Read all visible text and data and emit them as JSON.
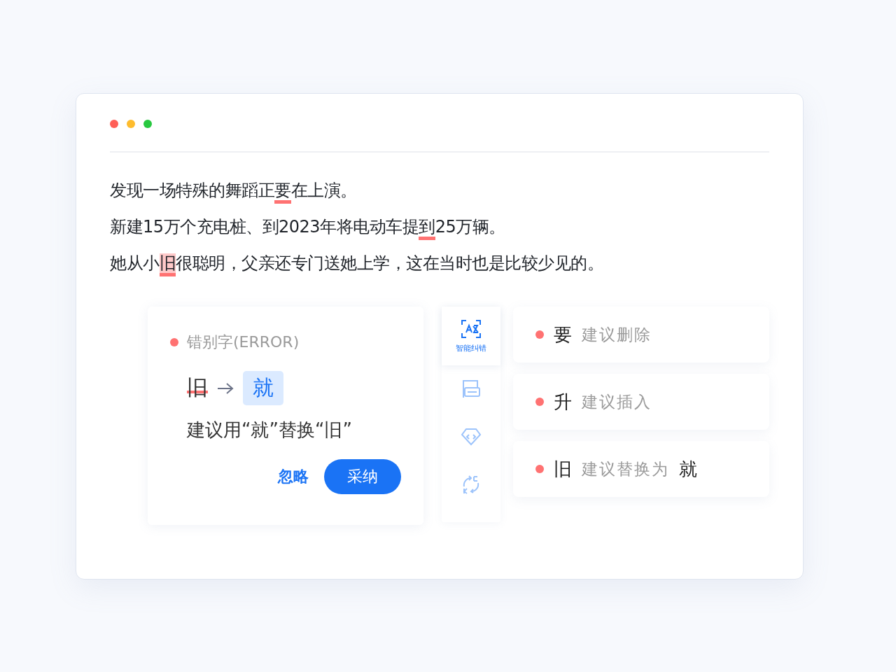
{
  "window": {
    "controls": [
      {
        "color": "#ff5f57"
      },
      {
        "color": "#febc2e"
      },
      {
        "color": "#28c840"
      }
    ]
  },
  "sentences": [
    {
      "segments": [
        {
          "kind": "plain",
          "text": "发现一场特殊的舞蹈正"
        },
        {
          "kind": "mark",
          "text": "要"
        },
        {
          "kind": "plain",
          "text": "在上演。"
        }
      ]
    },
    {
      "segments": [
        {
          "kind": "plain",
          "text": "新建15万个充电桩、到2023年将电动车提"
        },
        {
          "kind": "mark",
          "text": "到"
        },
        {
          "kind": "plain",
          "text": "25万辆。"
        }
      ]
    },
    {
      "segments": [
        {
          "kind": "plain",
          "text": "她从小"
        },
        {
          "kind": "highlight",
          "text": "旧"
        },
        {
          "kind": "plain",
          "text": "很聪明，父亲还专门送她上学，这在当时也是比较少见的。"
        }
      ]
    }
  ],
  "error_card": {
    "type": "错别字(ERROR)",
    "color": "#ff7272",
    "wrong": "旧",
    "right": "就",
    "explanation": "建议用“就”替换“旧”",
    "buttons": [
      {
        "kind": "text",
        "label": "忽略"
      },
      {
        "kind": "primary",
        "label": "采纳"
      }
    ]
  },
  "tools": [
    {
      "kind": "scan",
      "label": "智能纠错",
      "selected": true
    },
    {
      "kind": "doc",
      "selected": false
    },
    {
      "kind": "tag",
      "selected": false
    },
    {
      "kind": "sync",
      "selected": false
    }
  ],
  "suggestions": [
    {
      "word": "要",
      "action": "建议删除",
      "color": "#ff7272"
    },
    {
      "word": "升",
      "action": "建议插入",
      "color": "#ff7272"
    },
    {
      "word": "旧",
      "action": "建议替换为",
      "replacement": "就",
      "color": "#ff7272"
    }
  ]
}
